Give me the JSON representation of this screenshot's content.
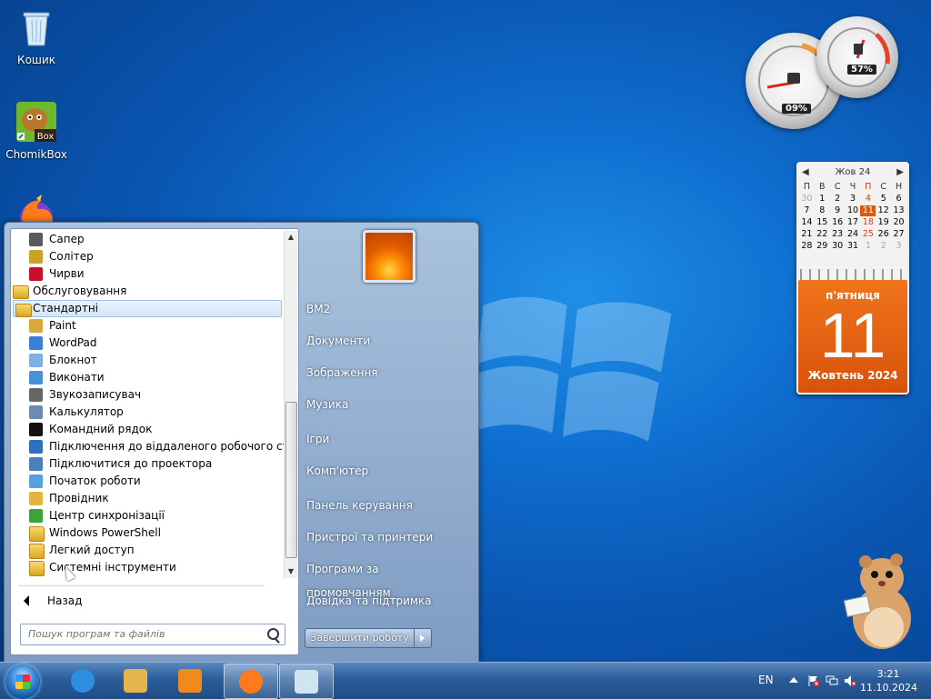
{
  "desktop": {
    "icons": [
      {
        "label": "Кошик",
        "icon": "recycle-bin-icon"
      },
      {
        "label": "ChomikBox",
        "icon": "chomikbox-icon",
        "badge": "Box"
      },
      {
        "label": "",
        "icon": "firefox-icon"
      }
    ]
  },
  "gadgets": {
    "cpu_meter": {
      "cpu_value": "09%",
      "ram_value": "57%"
    },
    "calendar": {
      "month_label": "Жов 24",
      "weekdays": [
        "П",
        "В",
        "С",
        "Ч",
        "П",
        "С",
        "Н"
      ],
      "weeks": [
        [
          "30",
          "1",
          "2",
          "3",
          "4",
          "5",
          "6"
        ],
        [
          "7",
          "8",
          "9",
          "10",
          "11",
          "12",
          "13"
        ],
        [
          "14",
          "15",
          "16",
          "17",
          "18",
          "19",
          "20"
        ],
        [
          "21",
          "22",
          "23",
          "24",
          "25",
          "26",
          "27"
        ],
        [
          "28",
          "29",
          "30",
          "31",
          "1",
          "2",
          "3"
        ]
      ],
      "today": "11",
      "day_of_week": "п'ятниця",
      "day_number": "11",
      "month_year": "Жовтень 2024"
    }
  },
  "start_menu": {
    "programs": [
      {
        "label": "Сапер",
        "type": "app",
        "icon": "minesweeper-icon",
        "color": "#5a5a5a"
      },
      {
        "label": "Солітер",
        "type": "app",
        "icon": "solitaire-icon",
        "color": "#c9a227"
      },
      {
        "label": "Чирви",
        "type": "app",
        "icon": "hearts-icon",
        "color": "#c8102e"
      },
      {
        "label": "Обслуговування",
        "type": "folder",
        "icon": "folder-icon"
      },
      {
        "label": "Стандартні",
        "type": "folder",
        "icon": "folder-icon",
        "selected": true
      },
      {
        "label": "Paint",
        "type": "app",
        "icon": "paint-icon",
        "color": "#d9a93c"
      },
      {
        "label": "WordPad",
        "type": "app",
        "icon": "wordpad-icon",
        "color": "#3b7fd4"
      },
      {
        "label": "Блокнот",
        "type": "app",
        "icon": "notepad-icon",
        "color": "#7fb2e0"
      },
      {
        "label": "Виконати",
        "type": "app",
        "icon": "run-icon",
        "color": "#4a90d9"
      },
      {
        "label": "Звукозаписувач",
        "type": "app",
        "icon": "microphone-icon",
        "color": "#666666"
      },
      {
        "label": "Калькулятор",
        "type": "app",
        "icon": "calculator-icon",
        "color": "#6d8bb0"
      },
      {
        "label": "Командний рядок",
        "type": "app",
        "icon": "command-prompt-icon",
        "color": "#111111"
      },
      {
        "label": "Підключення до віддаленого робочого стола",
        "type": "app",
        "icon": "remote-desktop-icon",
        "color": "#2f6fbf"
      },
      {
        "label": "Підключитися до проектора",
        "type": "app",
        "icon": "projector-icon",
        "color": "#4a7fb8"
      },
      {
        "label": "Початок роботи",
        "type": "app",
        "icon": "getting-started-icon",
        "color": "#5aa0e0"
      },
      {
        "label": "Провідник",
        "type": "app",
        "icon": "explorer-folder-icon",
        "color": "#e0b540"
      },
      {
        "label": "Центр синхронізації",
        "type": "app",
        "icon": "sync-center-icon",
        "color": "#3aa33a"
      },
      {
        "label": "Windows PowerShell",
        "type": "app-folder",
        "icon": "folder-icon"
      },
      {
        "label": "Легкий доступ",
        "type": "app-folder",
        "icon": "folder-icon"
      },
      {
        "label": "Системні інструменти",
        "type": "app-folder",
        "icon": "folder-icon"
      }
    ],
    "back_label": "Назад",
    "search_placeholder": "Пошук програм та файлів",
    "right_items": [
      "BM2",
      "Документи",
      "Зображення",
      "Музика",
      "Ігри",
      "Комп'ютер",
      "Панель керування",
      "Пристрої та принтери",
      "Програми за промовчанням",
      "Довідка та підтримка"
    ],
    "shutdown_label": "Завершити роботу"
  },
  "taskbar": {
    "pinned": [
      {
        "name": "internet-explorer",
        "icon": "internet-explorer-icon",
        "color": "#2d8fe0"
      },
      {
        "name": "explorer",
        "icon": "explorer-folder-icon",
        "color": "#e3b54a"
      },
      {
        "name": "media-player",
        "icon": "media-player-icon",
        "color": "#f08a1c"
      },
      {
        "name": "firefox",
        "icon": "firefox-icon",
        "color": "#ff7a1a",
        "active": true
      },
      {
        "name": "app",
        "icon": "app-window-icon",
        "color": "#cfe6f0",
        "active": true
      }
    ],
    "language": "EN",
    "time": "3:21",
    "date": "11.10.2024"
  }
}
